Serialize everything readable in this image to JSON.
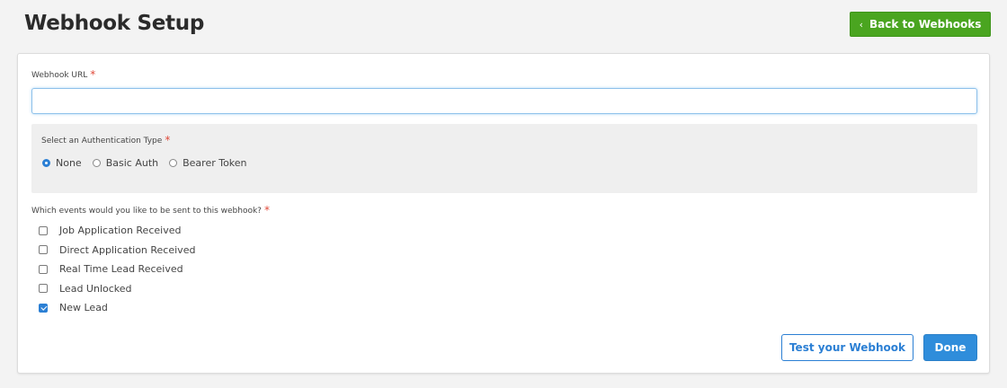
{
  "header": {
    "title": "Webhook Setup",
    "back_button": {
      "icon": "chevron-left-icon",
      "glyph": "‹",
      "label": "Back to Webhooks"
    }
  },
  "colors": {
    "back_button": "#4aa520",
    "primary": "#2b7fd4",
    "required": "#e04a3a"
  },
  "form": {
    "required_mark": "*",
    "webhook_url": {
      "label": "Webhook URL",
      "value": "",
      "placeholder": ""
    },
    "auth": {
      "label": "Select an Authentication Type",
      "options": [
        {
          "label": "None",
          "selected": true
        },
        {
          "label": "Basic Auth",
          "selected": false
        },
        {
          "label": "Bearer Token",
          "selected": false
        }
      ]
    },
    "events": {
      "label": "Which events would you like to be sent to this webhook?",
      "items": [
        {
          "label": "Job Application Received",
          "checked": false
        },
        {
          "label": "Direct Application Received",
          "checked": false
        },
        {
          "label": "Real Time Lead Received",
          "checked": false
        },
        {
          "label": "Lead Unlocked",
          "checked": false
        },
        {
          "label": "New Lead",
          "checked": true
        }
      ]
    },
    "buttons": {
      "test": "Test your Webhook",
      "done": "Done"
    }
  }
}
